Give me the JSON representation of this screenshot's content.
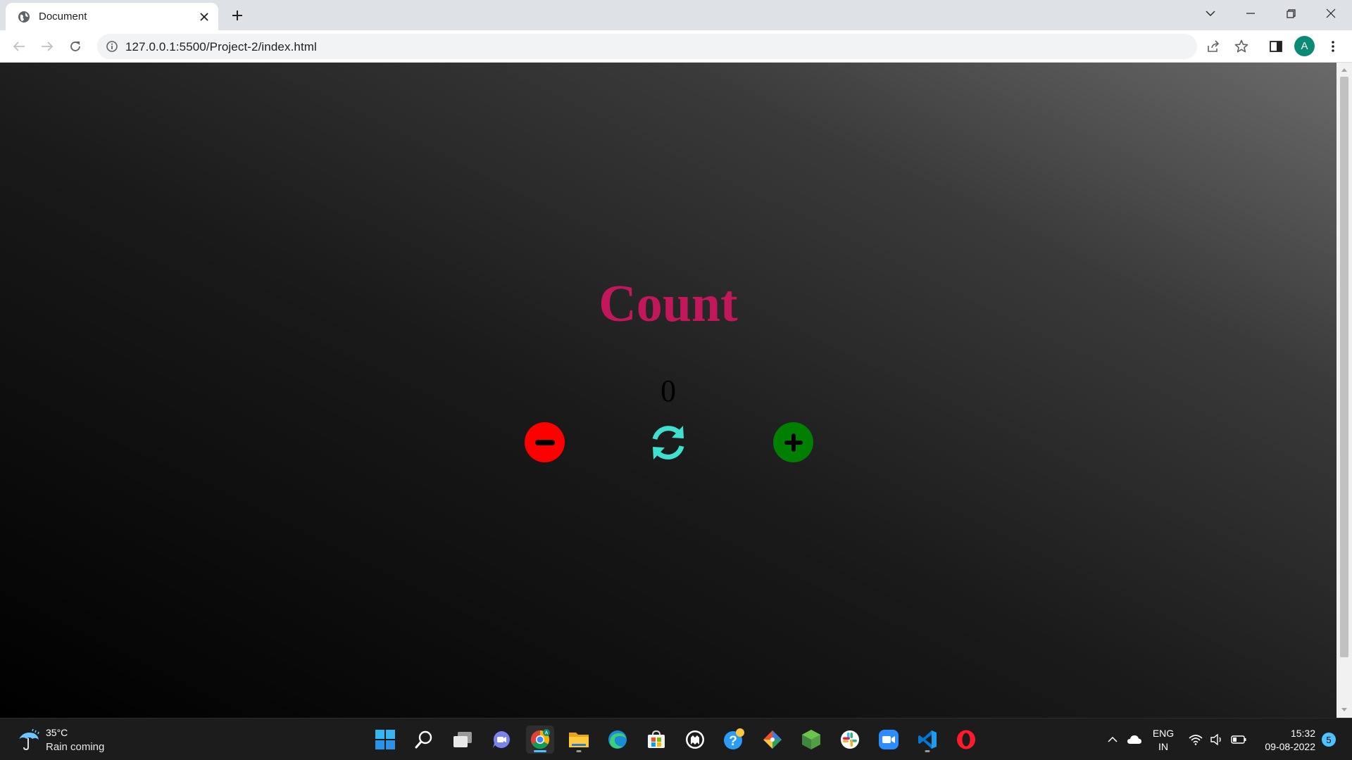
{
  "browser": {
    "tab": {
      "title": "Document"
    },
    "address": {
      "host": "127.0.0.1",
      "path": ":5500/Project-2/index.html"
    },
    "profile_initial": "A"
  },
  "page": {
    "title": "Count",
    "counter_value": "0",
    "buttons": {
      "decrement": "minus-circle-icon",
      "reset": "sync-icon",
      "increment": "plus-circle-icon"
    },
    "colors": {
      "title": "#c2185b",
      "decrement": "#ff0000",
      "reset": "#40e0d0",
      "increment": "#008000"
    }
  },
  "taskbar": {
    "weather": {
      "temp": "35°C",
      "desc": "Rain coming"
    },
    "apps": [
      "start",
      "search",
      "task-view",
      "chat",
      "chrome",
      "file-explorer",
      "edge",
      "store",
      "github",
      "help",
      "git",
      "node",
      "slack",
      "zoom",
      "vscode",
      "opera"
    ],
    "language": {
      "line1": "ENG",
      "line2": "IN"
    },
    "clock": {
      "time": "15:32",
      "date": "09-08-2022"
    },
    "notification_count": "5"
  }
}
